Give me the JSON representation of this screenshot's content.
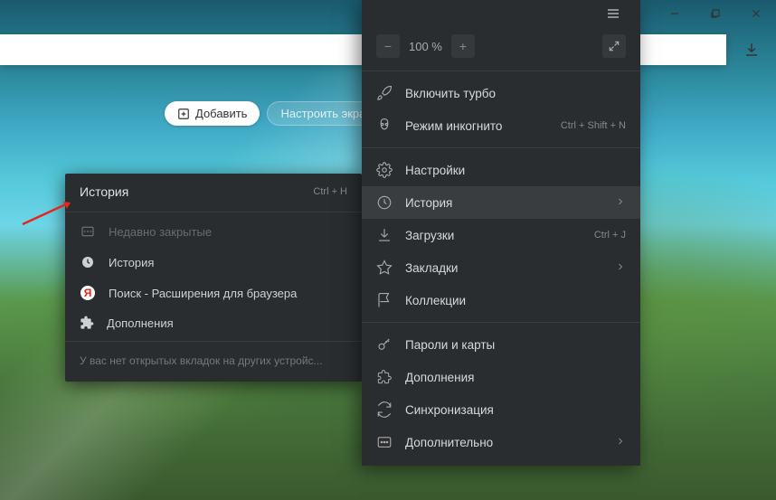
{
  "zoom": {
    "minus": "−",
    "value": "100 %",
    "plus": "+"
  },
  "buttons": {
    "add": "Добавить",
    "configure": "Настроить экра"
  },
  "menu": {
    "turbo": "Включить турбо",
    "incognito": {
      "label": "Режим инкогнито",
      "shortcut": "Ctrl + Shift + N"
    },
    "settings": "Настройки",
    "history": "История",
    "downloads": {
      "label": "Загрузки",
      "shortcut": "Ctrl + J"
    },
    "bookmarks": "Закладки",
    "collections": "Коллекции",
    "passwords": "Пароли и карты",
    "addons": "Дополнения",
    "sync": "Синхронизация",
    "more": "Дополнительно"
  },
  "submenu": {
    "title": "История",
    "shortcut": "Ctrl + H",
    "recently_closed": "Недавно закрытые",
    "history_item": "История",
    "search_item": "Поиск - Расширения для браузера",
    "addons_item": "Дополнения",
    "footer": "У вас нет открытых вкладок на других устройс..."
  },
  "yandex_letter": "Я"
}
